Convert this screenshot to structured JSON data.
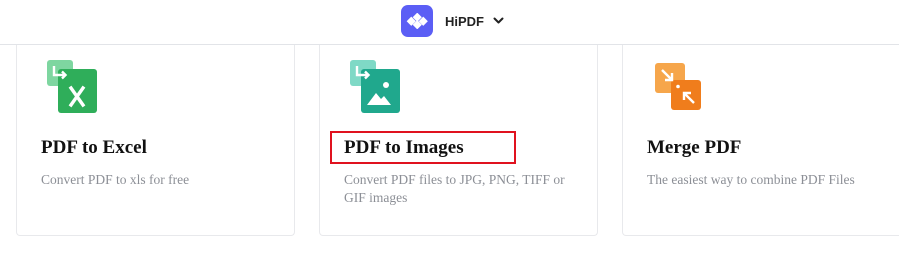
{
  "header": {
    "brand_name": "HiPDF",
    "logo_icon": "hipdf-logo-icon",
    "caret_icon": "chevron-down-icon"
  },
  "cards": [
    {
      "icon": "pdf-to-excel-icon",
      "title": "PDF to Excel",
      "description": "Convert PDF to xls for free",
      "colors": {
        "back": "#7ed6a0",
        "front": "#2fae5a"
      }
    },
    {
      "icon": "pdf-to-image-icon",
      "title": "PDF to Images",
      "description": "Convert PDF files to JPG, PNG, TIFF or GIF images",
      "colors": {
        "back": "#7fd9c6",
        "front": "#20a88d"
      }
    },
    {
      "icon": "merge-pdf-icon",
      "title": "Merge PDF",
      "description": "The easiest way to combine PDF Files",
      "colors": {
        "back": "#f6a64b",
        "front": "#f07d1c"
      }
    }
  ],
  "highlight": {
    "target": "PDF to Images",
    "color": "#e0121f"
  }
}
